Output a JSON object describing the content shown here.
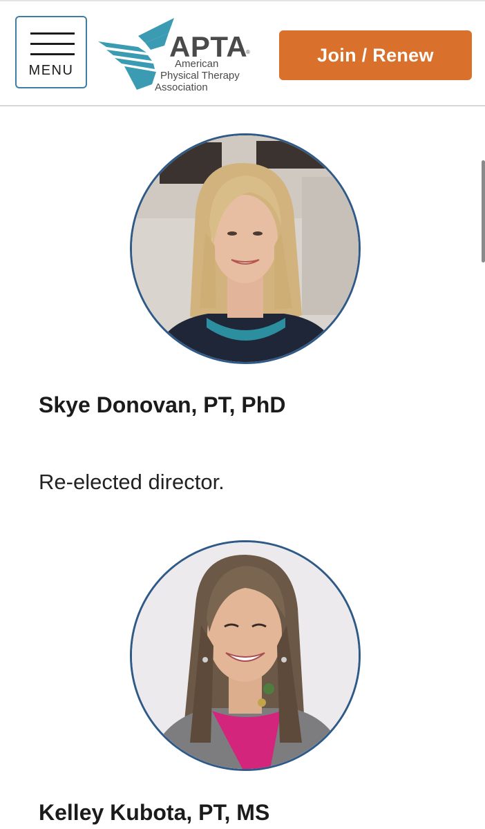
{
  "header": {
    "menu_label": "MENU",
    "menu_icon": "hamburger-icon",
    "logo": {
      "wordmark": "APTA",
      "reg_mark": "®",
      "line1": "American",
      "line2": "Physical Therapy",
      "line3": "Association",
      "colors": {
        "teal": "#3a9bb3",
        "navy": "#2a5d86",
        "gray": "#4a4a4a"
      }
    },
    "join_label": "Join / Renew",
    "join_color": "#d9702b"
  },
  "profiles": [
    {
      "photo_icon": "portrait-photo",
      "name": "Skye Donovan, PT, PhD",
      "role": "Re-elected director."
    },
    {
      "photo_icon": "portrait-photo",
      "name": "Kelley Kubota, PT, MS"
    }
  ],
  "colors": {
    "avatar_ring": "#2f5a87",
    "menu_border": "#3d7ea6"
  }
}
